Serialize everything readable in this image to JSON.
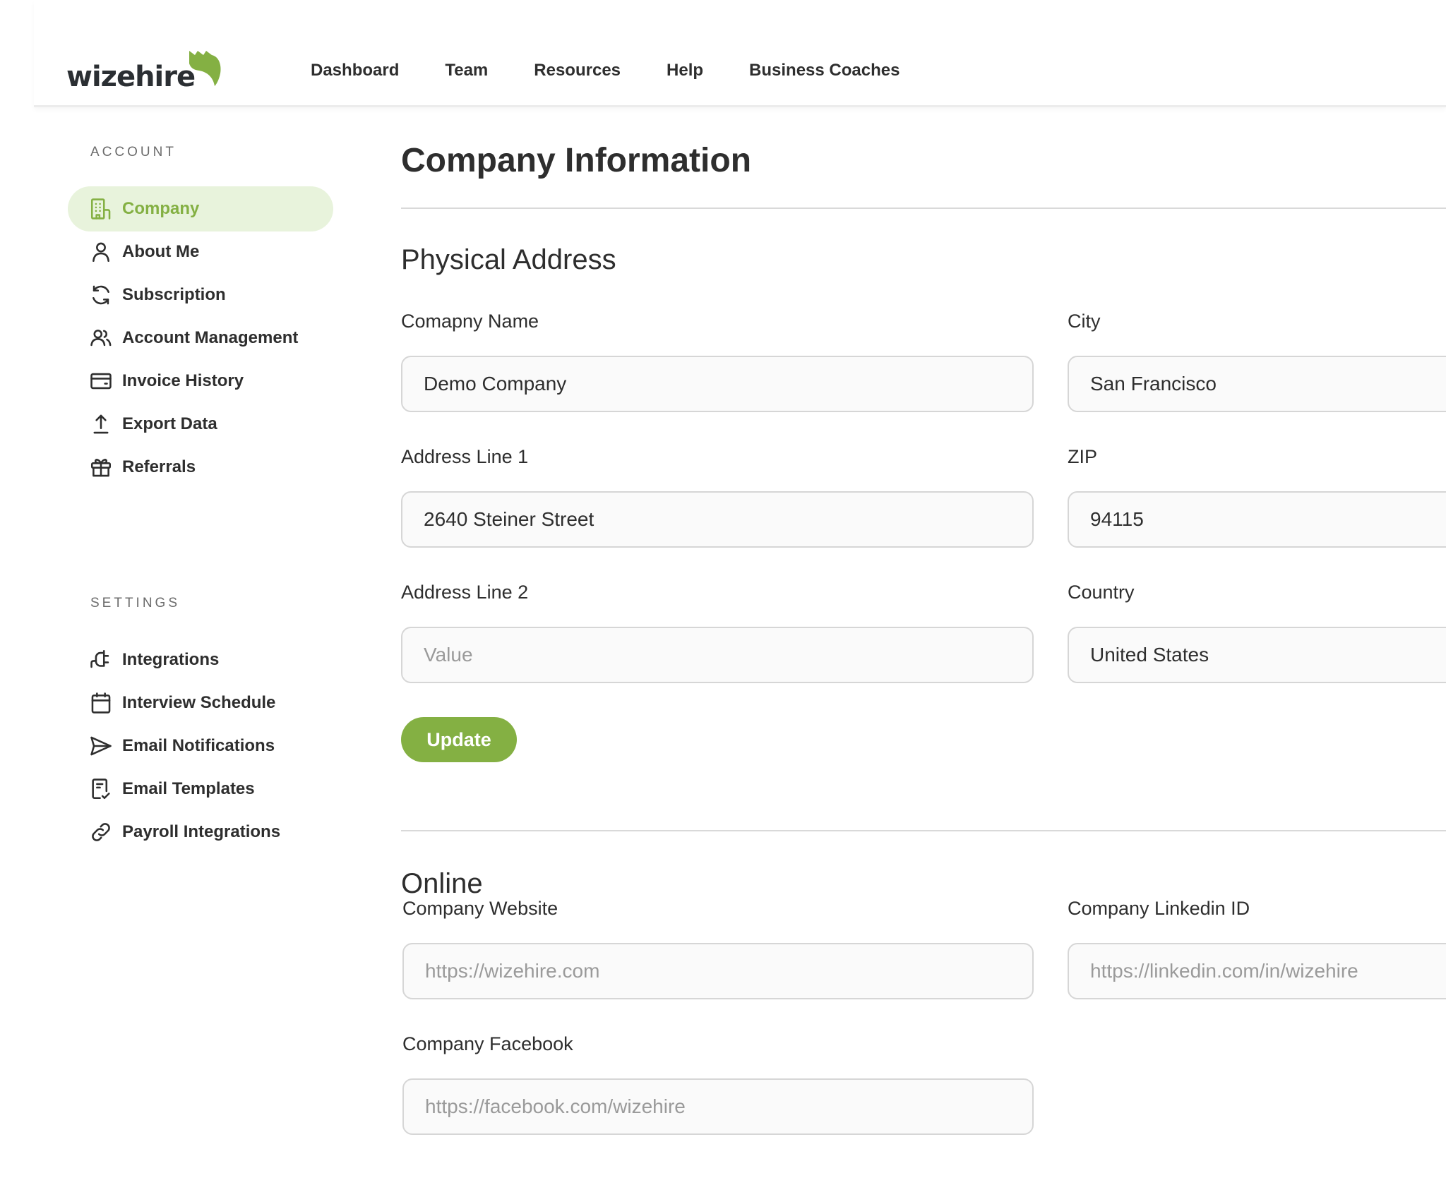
{
  "brand": {
    "name": "wizehire",
    "accent_color": "#84b043",
    "active_bg_color": "#e8f3dc"
  },
  "nav": {
    "items": [
      {
        "label": "Dashboard"
      },
      {
        "label": "Team"
      },
      {
        "label": "Resources"
      },
      {
        "label": "Help"
      },
      {
        "label": "Business Coaches"
      }
    ]
  },
  "sidebar": {
    "account_heading": "ACCOUNT",
    "settings_heading": "SETTINGS",
    "account_items": [
      {
        "label": "Company",
        "icon": "building-icon",
        "active": true
      },
      {
        "label": "About Me",
        "icon": "user-icon"
      },
      {
        "label": "Subscription",
        "icon": "refresh-icon"
      },
      {
        "label": "Account Management",
        "icon": "users-icon"
      },
      {
        "label": "Invoice History",
        "icon": "credit-card-icon"
      },
      {
        "label": "Export Data",
        "icon": "upload-icon"
      },
      {
        "label": "Referrals",
        "icon": "gift-icon"
      }
    ],
    "settings_items": [
      {
        "label": "Integrations",
        "icon": "plug-icon"
      },
      {
        "label": "Interview Schedule",
        "icon": "calendar-icon"
      },
      {
        "label": "Email Notifications",
        "icon": "send-icon"
      },
      {
        "label": "Email Templates",
        "icon": "document-check-icon"
      },
      {
        "label": "Payroll Integrations",
        "icon": "link-icon"
      }
    ]
  },
  "main": {
    "title": "Company Information",
    "physical_address": {
      "heading": "Physical Address",
      "fields": {
        "company_name": {
          "label": "Comapny Name",
          "value": "Demo Company",
          "placeholder": ""
        },
        "city": {
          "label": "City",
          "value": "San Francisco",
          "placeholder": ""
        },
        "address1": {
          "label": "Address Line 1",
          "value": "2640 Steiner Street",
          "placeholder": ""
        },
        "zip": {
          "label": "ZIP",
          "value": "94115",
          "placeholder": ""
        },
        "address2": {
          "label": "Address Line 2",
          "value": "",
          "placeholder": "Value"
        },
        "country": {
          "label": "Country",
          "value": "United States",
          "placeholder": ""
        }
      },
      "update_label": "Update"
    },
    "online": {
      "heading": "Online",
      "fields": {
        "website": {
          "label": "Company Website",
          "value": "",
          "placeholder": "https://wizehire.com"
        },
        "linkedin": {
          "label": "Company Linkedin ID",
          "value": "",
          "placeholder": "https://linkedin.com/in/wizehire"
        },
        "facebook": {
          "label": "Company Facebook",
          "value": "",
          "placeholder": "https://facebook.com/wizehire"
        }
      }
    }
  }
}
